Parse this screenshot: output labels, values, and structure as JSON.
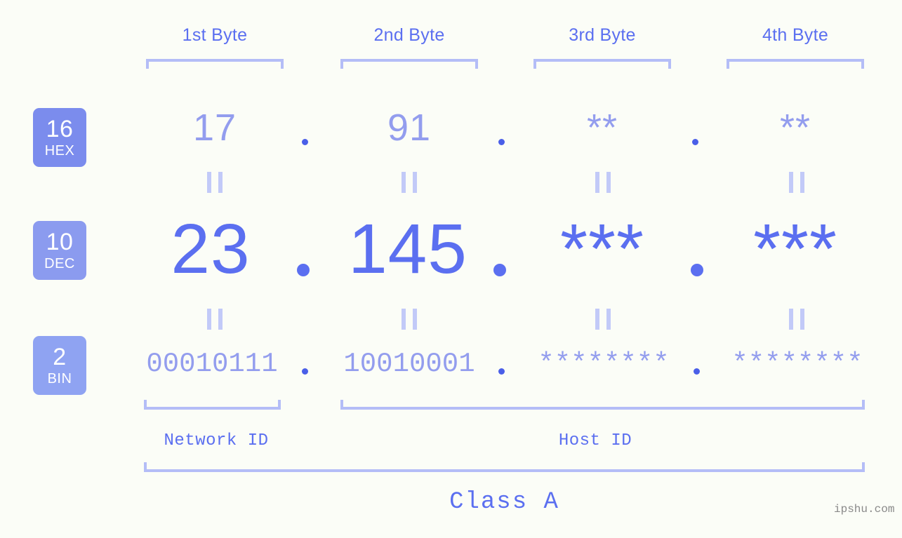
{
  "background_color": "#fbfdf7",
  "accent_color": "#5b6ff0",
  "accent_light_color": "#939dee",
  "bracket_color": "#b4bdf7",
  "byte_headers": [
    {
      "label": "1st Byte"
    },
    {
      "label": "2nd Byte"
    },
    {
      "label": "3rd Byte"
    },
    {
      "label": "4th Byte"
    }
  ],
  "rows": {
    "hex": {
      "badge_number": "16",
      "badge_name": "HEX",
      "badge_color": "#7b8ced",
      "values": [
        "17",
        "91",
        "**",
        "**"
      ],
      "separator": "."
    },
    "dec": {
      "badge_number": "10",
      "badge_name": "DEC",
      "badge_color": "#8b9bef",
      "values": [
        "23",
        "145",
        "***",
        "***"
      ],
      "separator": "."
    },
    "bin": {
      "badge_number": "2",
      "badge_name": "BIN",
      "badge_color": "#8fa3f2",
      "values": [
        "00010111",
        "10010001",
        "********",
        "********"
      ],
      "separator": "."
    }
  },
  "equals_symbol": "=",
  "id_labels": {
    "network": "Network ID",
    "host": "Host ID"
  },
  "class_label": "Class A",
  "watermark": "ipshu.com",
  "chart_data": {
    "type": "table",
    "title": "IP address byte breakdown",
    "categories": [
      "1st Byte",
      "2nd Byte",
      "3rd Byte",
      "4th Byte"
    ],
    "series": [
      {
        "name": "HEX",
        "values": [
          "17",
          "91",
          "**",
          "**"
        ]
      },
      {
        "name": "DEC",
        "values": [
          "23",
          "145",
          "***",
          "***"
        ]
      },
      {
        "name": "BIN",
        "values": [
          "00010111",
          "10010001",
          "********",
          "********"
        ]
      }
    ],
    "annotations": [
      "Network ID",
      "Host ID",
      "Class A"
    ]
  }
}
